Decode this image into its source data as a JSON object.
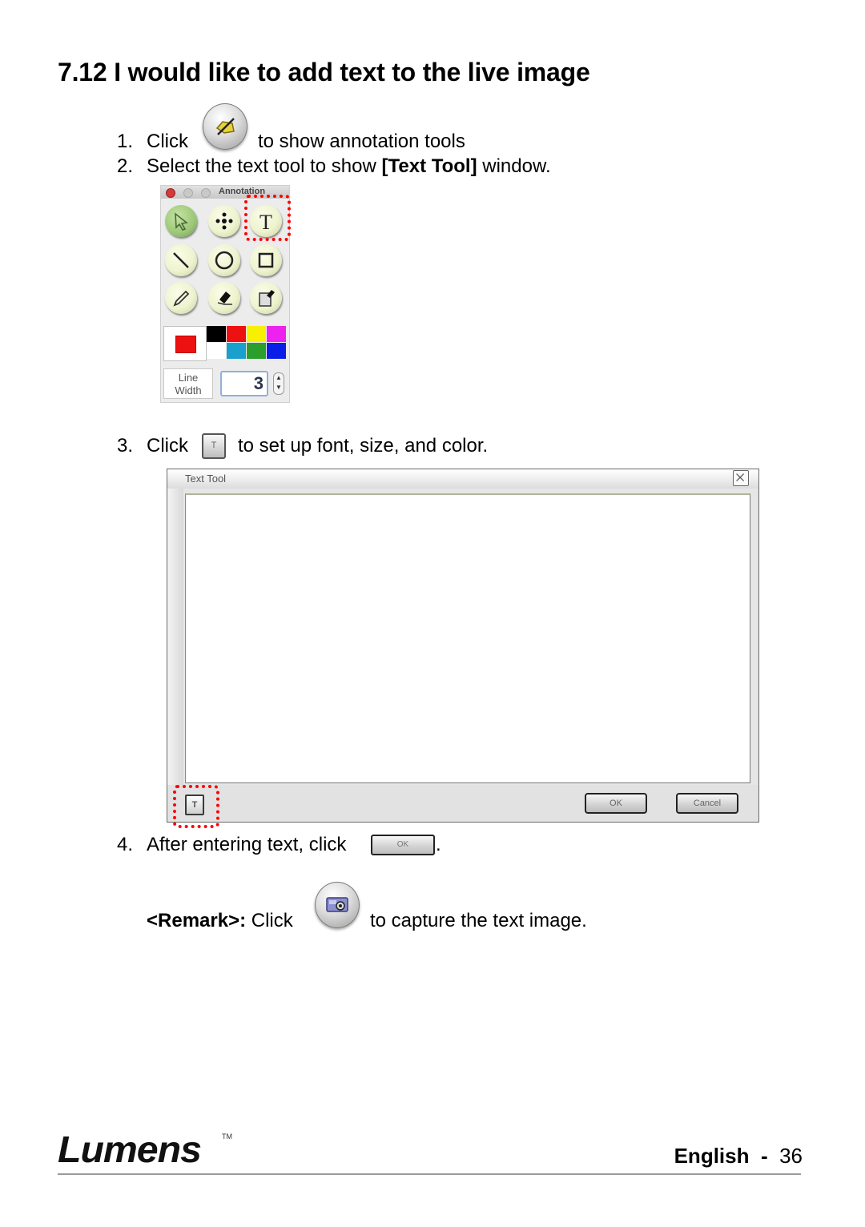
{
  "section": {
    "number": "7.12",
    "title": "I would like to add text to the live image"
  },
  "steps": [
    {
      "num": "1.",
      "before": "Click",
      "after": "to show annotation tools",
      "icon": "annotation-pen-icon"
    },
    {
      "num": "2.",
      "text_plain": "Select the text tool to show ",
      "text_bold": "[Text Tool]",
      "text_end": " window."
    },
    {
      "num": "3.",
      "before": "Click",
      "after": "to set up font, size, and color.",
      "icon": "font-settings-icon"
    },
    {
      "num": "4.",
      "before": "After entering text, click",
      "after": ".",
      "icon": "ok-button"
    }
  ],
  "annotation_palette": {
    "title": "Annotation",
    "tools": [
      {
        "name": "select",
        "icon": "arrow-cursor-icon",
        "active": true
      },
      {
        "name": "move",
        "icon": "move-cross-icon"
      },
      {
        "name": "text",
        "icon": "text-t-icon",
        "highlighted": true
      },
      {
        "name": "line",
        "icon": "line-icon"
      },
      {
        "name": "circle",
        "icon": "circle-icon"
      },
      {
        "name": "rectangle",
        "icon": "rectangle-icon"
      },
      {
        "name": "pencil",
        "icon": "pencil-icon"
      },
      {
        "name": "eraser",
        "icon": "eraser-icon"
      },
      {
        "name": "clear",
        "icon": "clear-page-icon"
      }
    ],
    "current_color": "#ee1111",
    "swatches": [
      "#000000",
      "#ee1111",
      "#f7f000",
      "#ee22ee",
      "#ffffff",
      "#1aa0cc",
      "#2c9e2c",
      "#0a1ee8"
    ],
    "line_width_label": [
      "Line",
      "Width"
    ],
    "line_width_value": "3"
  },
  "text_tool_window": {
    "title": "Text Tool",
    "font_button_label": "T",
    "ok_label": "OK",
    "cancel_label": "Cancel",
    "close_icon": "close-x-icon"
  },
  "inline": {
    "font_button_label": "T",
    "ok_label": "OK"
  },
  "remark": {
    "label": "<Remark>:",
    "before": "Click",
    "after": "to capture the text image.",
    "icon": "camera-capture-icon"
  },
  "footer": {
    "brand": "Lumens",
    "trademark": "TM",
    "language": "English",
    "separator": "-",
    "page": "36"
  },
  "colors": {
    "highlight": "#ff0000",
    "rule": "#9a9a9a"
  }
}
